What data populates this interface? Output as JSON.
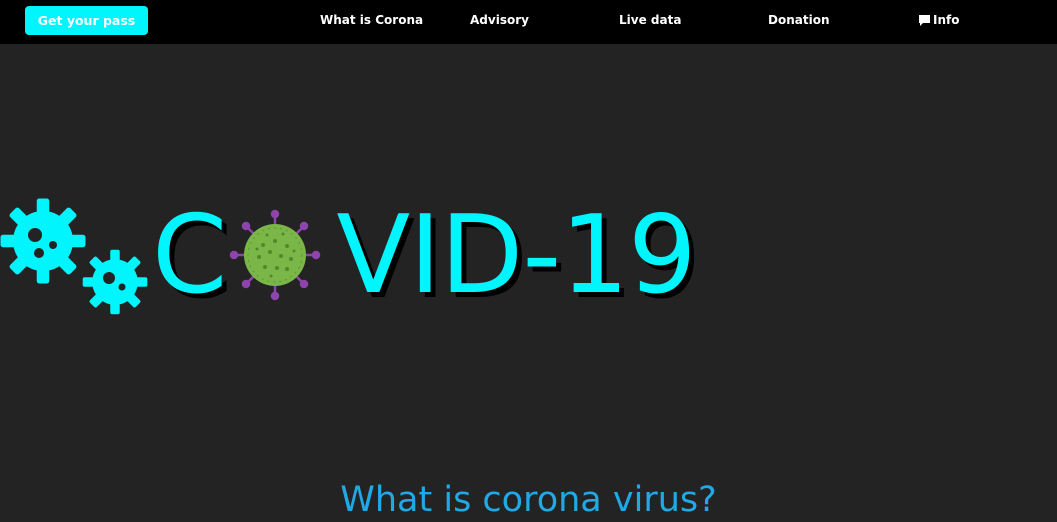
{
  "navbar": {
    "pass_button": "Get your pass",
    "links": [
      "What is Corona",
      "Advisory",
      "Live data",
      "Donation"
    ],
    "info_label": "Info",
    "info_icon": "speech-bubble-icon"
  },
  "hero": {
    "title_first": "C",
    "title_rest": "VID-19",
    "accent_color": "#00f5fd",
    "virus_color": "#7ab648",
    "spike_color": "#8e44ad"
  },
  "section": {
    "title": "What is corona virus?"
  }
}
